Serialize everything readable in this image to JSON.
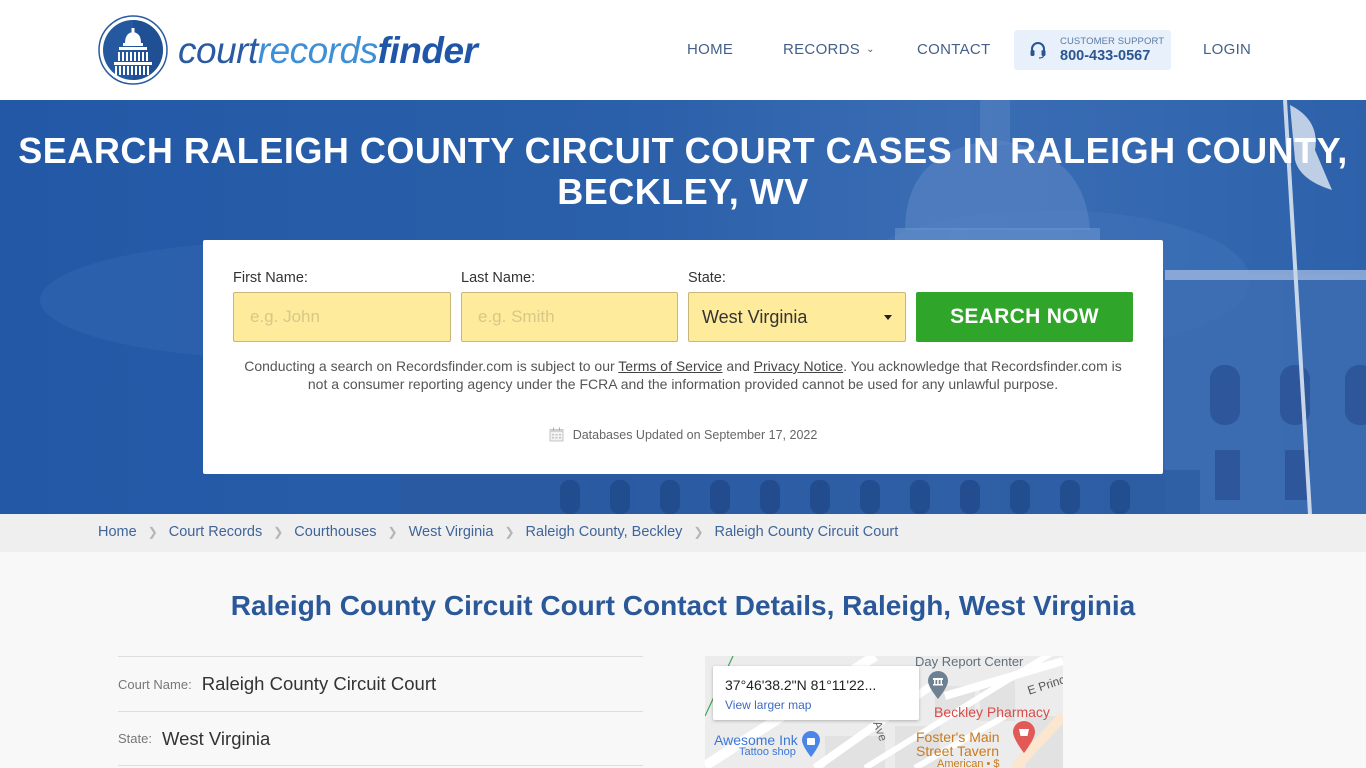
{
  "brand": {
    "logo_parts": [
      "court",
      "records",
      "finder"
    ],
    "logo_icon": "capitol-dome-icon"
  },
  "nav": {
    "items": [
      {
        "label": "HOME"
      },
      {
        "label": "RECORDS",
        "has_dropdown": true
      },
      {
        "label": "CONTACT"
      },
      {
        "label": "LOGIN"
      }
    ],
    "support": {
      "label": "CUSTOMER SUPPORT",
      "phone": "800-433-0567",
      "icon": "headset-icon"
    }
  },
  "hero": {
    "title": "SEARCH RALEIGH COUNTY CIRCUIT COURT CASES IN RALEIGH COUNTY, BECKLEY, WV"
  },
  "search_form": {
    "first_name": {
      "label": "First Name:",
      "value": "",
      "placeholder": "e.g. John"
    },
    "last_name": {
      "label": "Last Name:",
      "value": "",
      "placeholder": "e.g. Smith"
    },
    "state": {
      "label": "State:",
      "selected": "West Virginia"
    },
    "submit_label": "SEARCH NOW",
    "disclaimer": {
      "part1": "Conducting a search on Recordsfinder.com is subject to our ",
      "terms_link": "Terms of Service",
      "part2": " and ",
      "privacy_link": "Privacy Notice",
      "part3": ". You acknowledge that Recordsfinder.com is not a consumer reporting agency under the FCRA and the information provided cannot be used for any unlawful purpose."
    },
    "db_updated": "Databases Updated on September 17, 2022"
  },
  "breadcrumb": {
    "items": [
      "Home",
      "Court Records",
      "Courthouses",
      "West Virginia",
      "Raleigh County, Beckley"
    ],
    "current": "Raleigh County Circuit Court"
  },
  "main": {
    "title": "Raleigh County Circuit Court Contact Details, Raleigh, West Virginia",
    "details": [
      {
        "label": "Court Name:",
        "value": "Raleigh County Circuit Court"
      },
      {
        "label": "State:",
        "value": "West Virginia"
      }
    ]
  },
  "map": {
    "coords": "37°46'38.2\"N 81°11'22...",
    "larger_link": "View larger map",
    "pois": {
      "day_report": "Day Report Center",
      "pharmacy": "Beckley Pharmacy",
      "ink": "Awesome Ink",
      "ink_type": "Tattoo shop",
      "tavern_l1": "Foster's Main",
      "tavern_l2": "Street Tavern",
      "tavern_type": "American • $",
      "street_e": "E Princ",
      "street_ave": "Ave"
    },
    "colors": {
      "pharmacy": "#d84c4a",
      "tavern": "#c97a1e",
      "ink": "#3b78d8",
      "civic": "#6d8192"
    }
  }
}
